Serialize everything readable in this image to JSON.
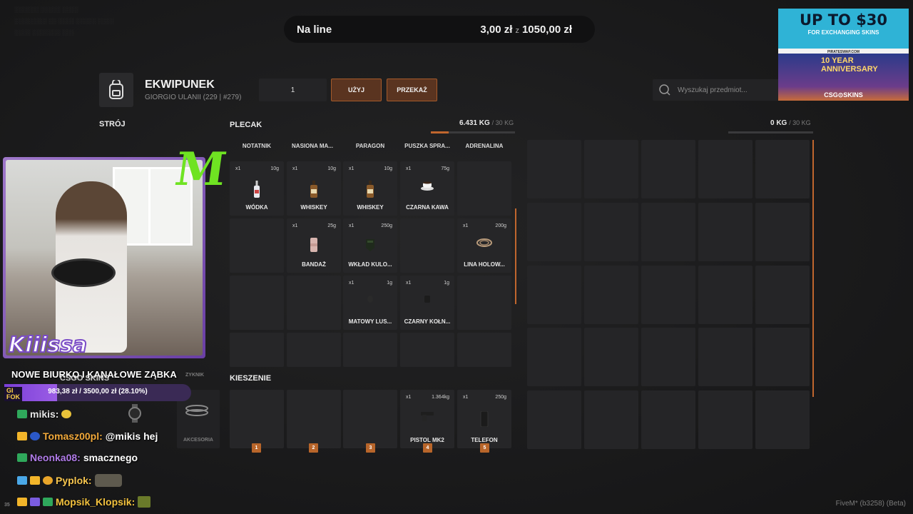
{
  "topbar": {
    "title": "Na line",
    "amount": "3,00 zł",
    "sep": "z",
    "total": "1050,00 zł"
  },
  "header": {
    "title": "EKWIPUNEK",
    "subtitle": "GIORGIO ULANII (229 | #279)",
    "quantity": "1",
    "use_label": "UŻYJ",
    "give_label": "PRZEKAŻ",
    "search_placeholder": "Wyszukaj przedmiot..."
  },
  "sections": {
    "outfit": "STRÓJ",
    "backpack": "PLECAK",
    "backpack_weight": "6.431 KG",
    "backpack_max": "/ 30 KG",
    "backpack_fill": 0.21,
    "right_weight": "0 KG",
    "right_max": "/ 30 KG",
    "pockets": "KIESZENIE"
  },
  "columns": [
    "NOTATNIK",
    "NASIONA MA...",
    "PARAGON",
    "PUSZKA SPRA...",
    "ADRENALINA"
  ],
  "items": {
    "wodka": {
      "count": "x1",
      "weight": "10g",
      "name": "WÓDKA"
    },
    "whiskey1": {
      "count": "x1",
      "weight": "10g",
      "name": "WHISKEY"
    },
    "whiskey2": {
      "count": "x1",
      "weight": "10g",
      "name": "WHISKEY"
    },
    "kawa": {
      "count": "x1",
      "weight": "75g",
      "name": "CZARNA KAWA"
    },
    "bandaz": {
      "count": "x1",
      "weight": "25g",
      "name": "BANDAŻ"
    },
    "wklad": {
      "count": "x1",
      "weight": "250g",
      "name": "WKŁAD KULO..."
    },
    "lina": {
      "count": "x1",
      "weight": "200g",
      "name": "LINA HOLOW..."
    },
    "lustro": {
      "count": "x1",
      "weight": "1g",
      "name": "MATOWY LUS..."
    },
    "kolnierz": {
      "count": "x1",
      "weight": "1g",
      "name": "CZARNY KOŁN..."
    },
    "pistol": {
      "count": "x1",
      "weight": "1.364kg",
      "name": "PISTOL MK2"
    },
    "telefon": {
      "count": "x1",
      "weight": "250g",
      "name": "TELEFON"
    }
  },
  "hotkeys": [
    "1",
    "2",
    "3",
    "4",
    "5"
  ],
  "side": {
    "slot1": "AKCESORIA",
    "slot2": "ZYKNIK"
  },
  "stream": {
    "streamer": "Kiiissa",
    "goal_title": "NOWE BIURKO I KANAŁOWE ZĄBKA",
    "goal_text": "983,38 zł / 3500,00 zł (28.10%)",
    "goal_fraction": 0.281,
    "goal_badge_1": "GI",
    "goal_badge_2": "FOK",
    "csgo_text": "CSGO SKINS",
    "monster_text": "M"
  },
  "chat": [
    {
      "user": "mikis:",
      "msg": ""
    },
    {
      "user": "Tomasz00pl:",
      "msg": "@mikis hej"
    },
    {
      "user": "Neonka08:",
      "msg": "smacznego"
    },
    {
      "user": "Pyplok:",
      "msg": ""
    },
    {
      "user": "Mopsik_Klopsik:",
      "msg": ""
    }
  ],
  "ads": {
    "ad1_big": "UP TO $30",
    "ad1_small": "FOR EXCHANGING SKINS",
    "ad1_foot": "PIRATESWAP.COM",
    "ad2_anniv": "10 YEAR ANNIVERSARY",
    "ad2_brand": "CSG⊙SKINS"
  },
  "footer": {
    "fivem": "FiveM* (b3258) (Beta)",
    "left_count": "35"
  },
  "colors": {
    "accent": "#c0662e",
    "slot": "#262628",
    "bg": "#1c1c1d"
  }
}
